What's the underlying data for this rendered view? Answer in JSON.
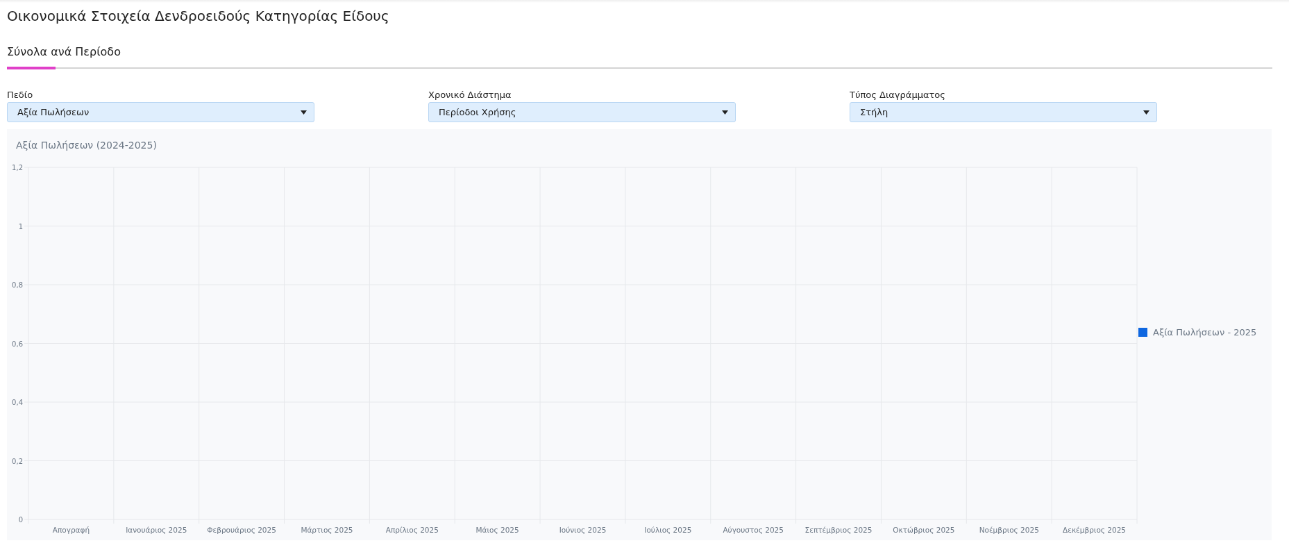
{
  "page_title": "Οικονομικά Στοιχεία Δενδροειδούς Κατηγορίας Είδους",
  "tabs": [
    {
      "label": "Σύνολα ανά Περίοδο",
      "selected": true
    }
  ],
  "filters": [
    {
      "label": "Πεδίο",
      "value": "Αξία Πωλήσεων"
    },
    {
      "label": "Χρονικό Διάστημα",
      "value": "Περίοδοι Χρήσης"
    },
    {
      "label": "Τύπος Διαγράμματος",
      "value": "Στήλη"
    }
  ],
  "chart": {
    "chart_data": {
      "type": "bar",
      "title": "Αξία Πωλήσεων (2024-2025)",
      "categories": [
        "Απογραφή",
        "Ιανουάριος 2025",
        "Φεβρουάριος 2025",
        "Μάρτιος 2025",
        "Απρίλιος 2025",
        "Μάιος 2025",
        "Ιούνιος 2025",
        "Ιούλιος 2025",
        "Αύγουστος 2025",
        "Σεπτέμβριος 2025",
        "Οκτώβριος 2025",
        "Νοέμβριος 2025",
        "Δεκέμβριος 2025"
      ],
      "series": [
        {
          "name": "Αξία Πωλήσεων - 2025",
          "color": "#0f67e0",
          "values": [
            0,
            0,
            0,
            0,
            0,
            0,
            0,
            0,
            0,
            0,
            0,
            0,
            0
          ]
        }
      ],
      "ylim": [
        0,
        1.2
      ],
      "grid": true,
      "yticks": [
        {
          "value": 0,
          "label": "0"
        },
        {
          "value": 0.2,
          "label": "0,2"
        },
        {
          "value": 0.4,
          "label": "0,4"
        },
        {
          "value": 0.6,
          "label": "0,6"
        },
        {
          "value": 0.8,
          "label": "0,8"
        },
        {
          "value": 1,
          "label": "1"
        },
        {
          "value": 1.2,
          "label": "1,2"
        }
      ]
    }
  }
}
